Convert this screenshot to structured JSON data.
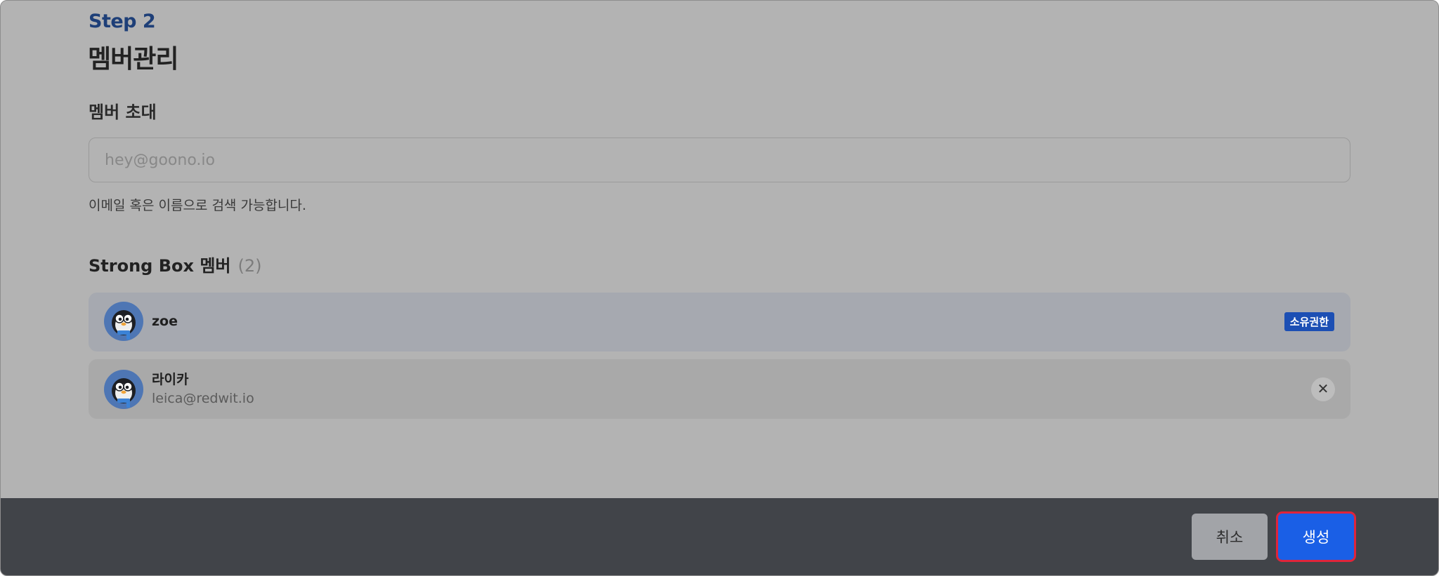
{
  "header": {
    "step": "Step 2",
    "title": "멤버관리"
  },
  "invite": {
    "label": "멤버 초대",
    "placeholder": "hey@goono.io",
    "hint": "이메일 혹은 이름으로 검색 가능합니다."
  },
  "members": {
    "title": "Strong Box 멤버",
    "count": "(2)",
    "list": [
      {
        "name": "zoe",
        "badge": "소유권한",
        "avatar": "penguin-avatar"
      },
      {
        "name": "라이카",
        "email": "leica@redwit.io",
        "avatar": "penguin-avatar",
        "remove_icon": "close-icon"
      }
    ]
  },
  "footer": {
    "cancel_label": "취소",
    "create_label": "생성"
  },
  "colors": {
    "step": "#1e3f78",
    "badge": "#1c4fb4",
    "primary": "#1a5fe6",
    "highlight": "#e0243a"
  }
}
